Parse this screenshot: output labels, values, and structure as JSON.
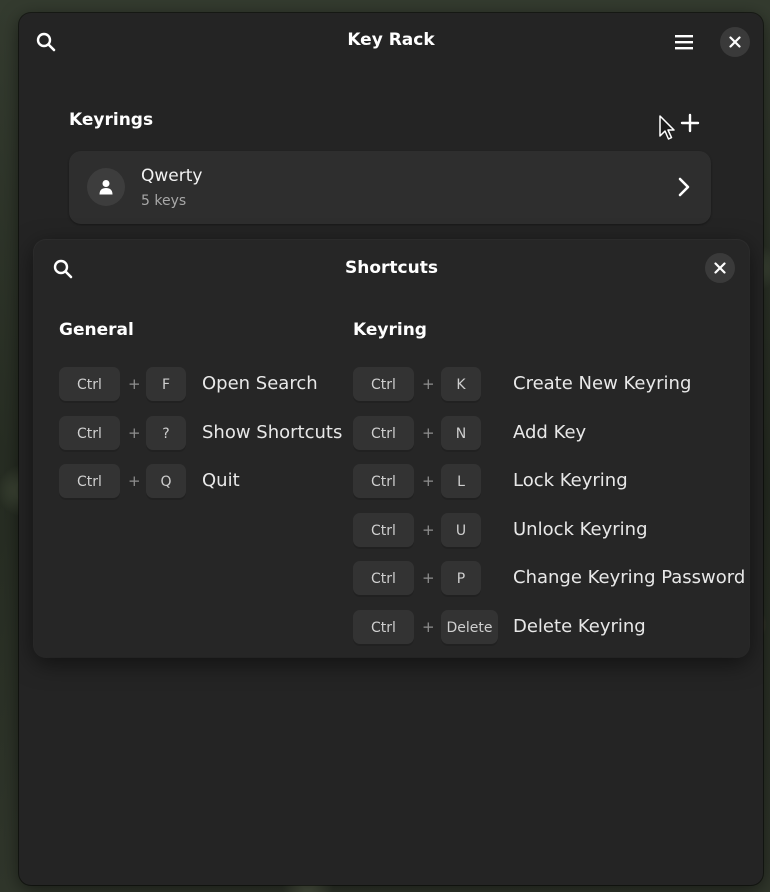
{
  "app": {
    "title": "Key Rack"
  },
  "keyrings": {
    "section_title": "Keyrings",
    "items": [
      {
        "name": "Qwerty",
        "subtitle": "5 keys"
      }
    ]
  },
  "shortcuts": {
    "title": "Shortcuts",
    "columns": [
      {
        "title": "General",
        "rows": [
          {
            "mod": "Ctrl",
            "plus": "+",
            "key": "F",
            "label": "Open Search"
          },
          {
            "mod": "Ctrl",
            "plus": "+",
            "key": "?",
            "label": "Show Shortcuts"
          },
          {
            "mod": "Ctrl",
            "plus": "+",
            "key": "Q",
            "label": "Quit"
          }
        ]
      },
      {
        "title": "Keyring",
        "rows": [
          {
            "mod": "Ctrl",
            "plus": "+",
            "key": "K",
            "label": "Create New Keyring"
          },
          {
            "mod": "Ctrl",
            "plus": "+",
            "key": "N",
            "label": "Add Key"
          },
          {
            "mod": "Ctrl",
            "plus": "+",
            "key": "L",
            "label": "Lock Keyring"
          },
          {
            "mod": "Ctrl",
            "plus": "+",
            "key": "U",
            "label": "Unlock Keyring"
          },
          {
            "mod": "Ctrl",
            "plus": "+",
            "key": "P",
            "label": "Change Keyring Password"
          },
          {
            "mod": "Ctrl",
            "plus": "+",
            "key": "Delete",
            "label": "Delete Keyring"
          }
        ]
      }
    ]
  },
  "icons": {
    "search": "search-icon",
    "menu": "hamburger-menu-icon",
    "close": "close-icon",
    "add": "plus-icon",
    "avatar": "person-icon",
    "chevron": "chevron-right-icon",
    "cursor": "mouse-pointer-icon"
  },
  "colors": {
    "window_bg": "#242424",
    "row_bg": "#2e2e2e",
    "key_bg": "#333333",
    "text": "#ffffff"
  }
}
